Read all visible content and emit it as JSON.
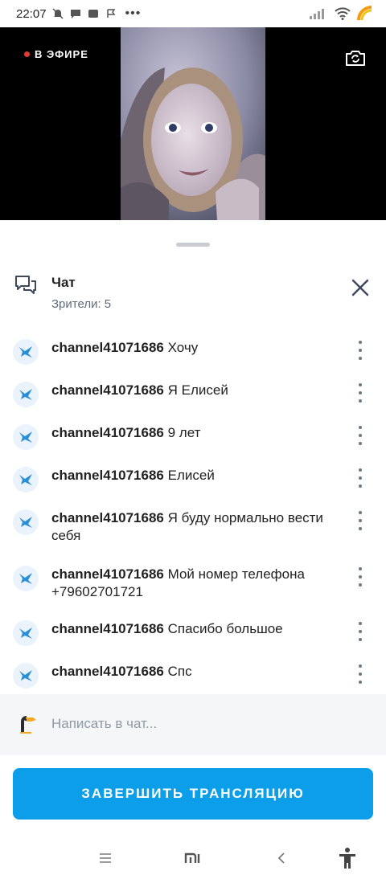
{
  "status_bar": {
    "time": "22:07",
    "more_indicator": "•••"
  },
  "stream": {
    "live_label": "В ЭФИРЕ",
    "camera_switch_icon": "camera-switch-icon"
  },
  "chat": {
    "title": "Чат",
    "viewers": "Зрители: 5",
    "messages": [
      {
        "author": "channel41071686",
        "text": "Хочу"
      },
      {
        "author": "channel41071686",
        "text": "Я Елисей"
      },
      {
        "author": "channel41071686",
        "text": "9 лет"
      },
      {
        "author": "channel41071686",
        "text": "Елисей"
      },
      {
        "author": "channel41071686",
        "text": "Я буду нормально вести себя"
      },
      {
        "author": "channel41071686",
        "text": "Мой номер телефона +79602701721"
      },
      {
        "author": "channel41071686",
        "text": "Спасибо большое"
      },
      {
        "author": "channel41071686",
        "text": "Спс"
      }
    ],
    "composer_placeholder": "Написать в чат..."
  },
  "actions": {
    "end_stream_label": "ЗАВЕРШИТЬ ТРАНСЛЯЦИЮ"
  },
  "colors": {
    "accent": "#0c9ee8",
    "live_dot": "#e53935",
    "avatar_bird": "#2a8fd6"
  }
}
